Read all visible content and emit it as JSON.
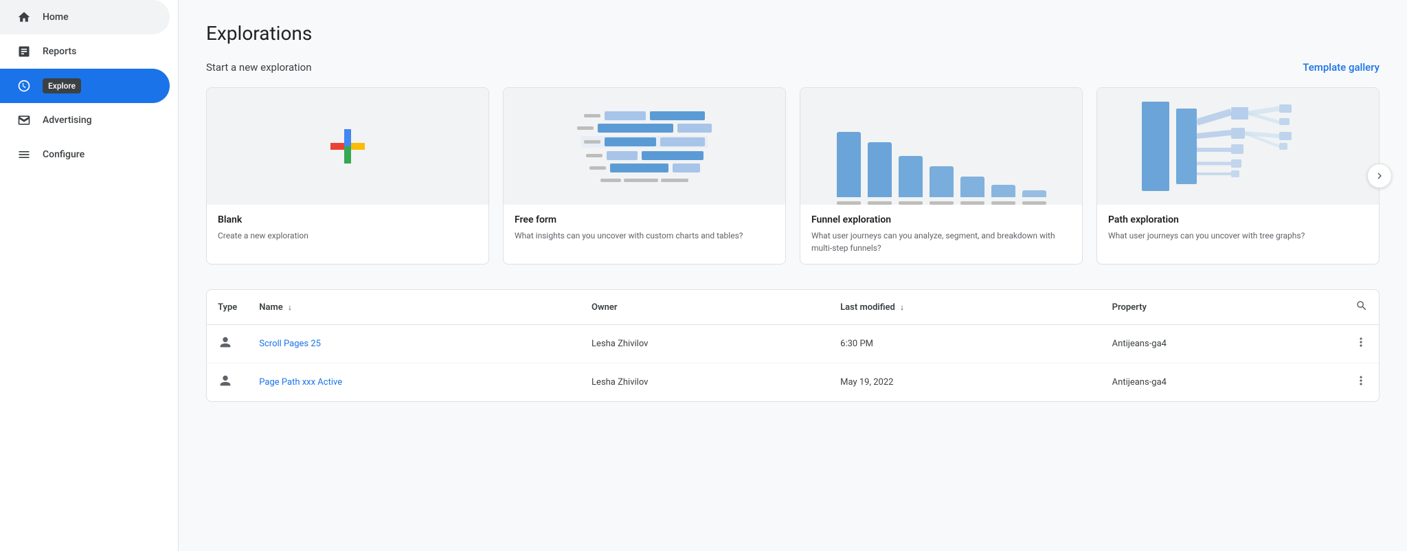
{
  "sidebar": {
    "items": [
      {
        "id": "home",
        "label": "Home",
        "icon": "🏠",
        "active": false
      },
      {
        "id": "reports",
        "label": "Reports",
        "icon": "📊",
        "active": false
      },
      {
        "id": "explore",
        "label": "Explore",
        "icon": "🔵",
        "active": true
      },
      {
        "id": "advertising",
        "label": "Advertising",
        "icon": "📋",
        "active": false
      },
      {
        "id": "configure",
        "label": "Configure",
        "icon": "☰",
        "active": false
      }
    ],
    "explore_tooltip": "Explore"
  },
  "main": {
    "page_title": "Explorations",
    "section_label": "Start a new exploration",
    "template_gallery_label": "Template gallery",
    "cards": [
      {
        "id": "blank",
        "title": "Blank",
        "desc": "Create a new exploration",
        "visual": "blank"
      },
      {
        "id": "free-form",
        "title": "Free form",
        "desc": "What insights can you uncover with custom charts and tables?",
        "visual": "freeform"
      },
      {
        "id": "funnel",
        "title": "Funnel exploration",
        "desc": "What user journeys can you analyze, segment, and breakdown with multi-step funnels?",
        "visual": "funnel"
      },
      {
        "id": "path",
        "title": "Path exploration",
        "desc": "What user journeys can you uncover with tree graphs?",
        "visual": "path"
      }
    ],
    "table": {
      "columns": [
        {
          "id": "type",
          "label": "Type",
          "sortable": false
        },
        {
          "id": "name",
          "label": "Name",
          "sortable": true
        },
        {
          "id": "owner",
          "label": "Owner",
          "sortable": false
        },
        {
          "id": "last_modified",
          "label": "Last modified",
          "sortable": true
        },
        {
          "id": "property",
          "label": "Property",
          "sortable": false
        }
      ],
      "rows": [
        {
          "type": "user",
          "name": "Scroll Pages 25",
          "owner": "Lesha Zhivilov",
          "last_modified": "6:30 PM",
          "property": "Antijeans-ga4"
        },
        {
          "type": "user",
          "name": "Page Path xxx Active",
          "owner": "Lesha Zhivilov",
          "last_modified": "May 19, 2022",
          "property": "Antijeans-ga4"
        }
      ]
    }
  }
}
